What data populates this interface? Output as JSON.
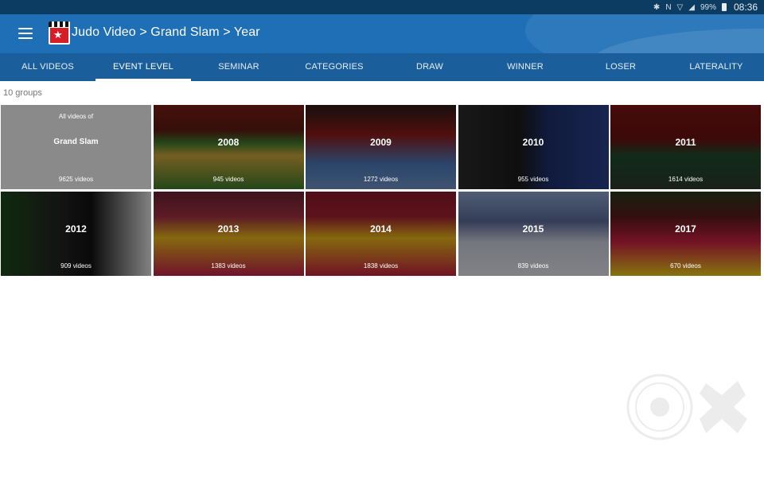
{
  "status_bar": {
    "battery": "99%",
    "time": "08:36"
  },
  "app_bar": {
    "title": "Judo Video > Grand Slam > Year"
  },
  "tabs": [
    {
      "label": "ALL VIDEOS",
      "active": false
    },
    {
      "label": "EVENT LEVEL",
      "active": true
    },
    {
      "label": "SEMINAR",
      "active": false
    },
    {
      "label": "CATEGORIES",
      "active": false
    },
    {
      "label": "DRAW",
      "active": false
    },
    {
      "label": "WINNER",
      "active": false
    },
    {
      "label": "LOSER",
      "active": false
    },
    {
      "label": "LATERALITY",
      "active": false
    }
  ],
  "group_count": "10 groups",
  "tiles": [
    {
      "type": "all",
      "subtitle": "All videos of",
      "name": "Grand Slam",
      "count": "9625 videos"
    },
    {
      "year": "2008",
      "count": "945 videos"
    },
    {
      "year": "2009",
      "count": "1272 videos"
    },
    {
      "year": "2010",
      "count": "955 videos"
    },
    {
      "year": "2011",
      "count": "1614 videos"
    },
    {
      "year": "2012",
      "count": "909 videos"
    },
    {
      "year": "2013",
      "count": "1383 videos"
    },
    {
      "year": "2014",
      "count": "1838 videos"
    },
    {
      "year": "2015",
      "count": "839 videos"
    },
    {
      "year": "2017",
      "count": "670 videos"
    }
  ],
  "colors": {
    "status_bar": "#0d3c63",
    "app_bar": "#1e6fb6",
    "tab_bar": "#1a5f9c",
    "tab_indicator": "#ffffff",
    "all_videos_tile": "#8a8a8a"
  }
}
